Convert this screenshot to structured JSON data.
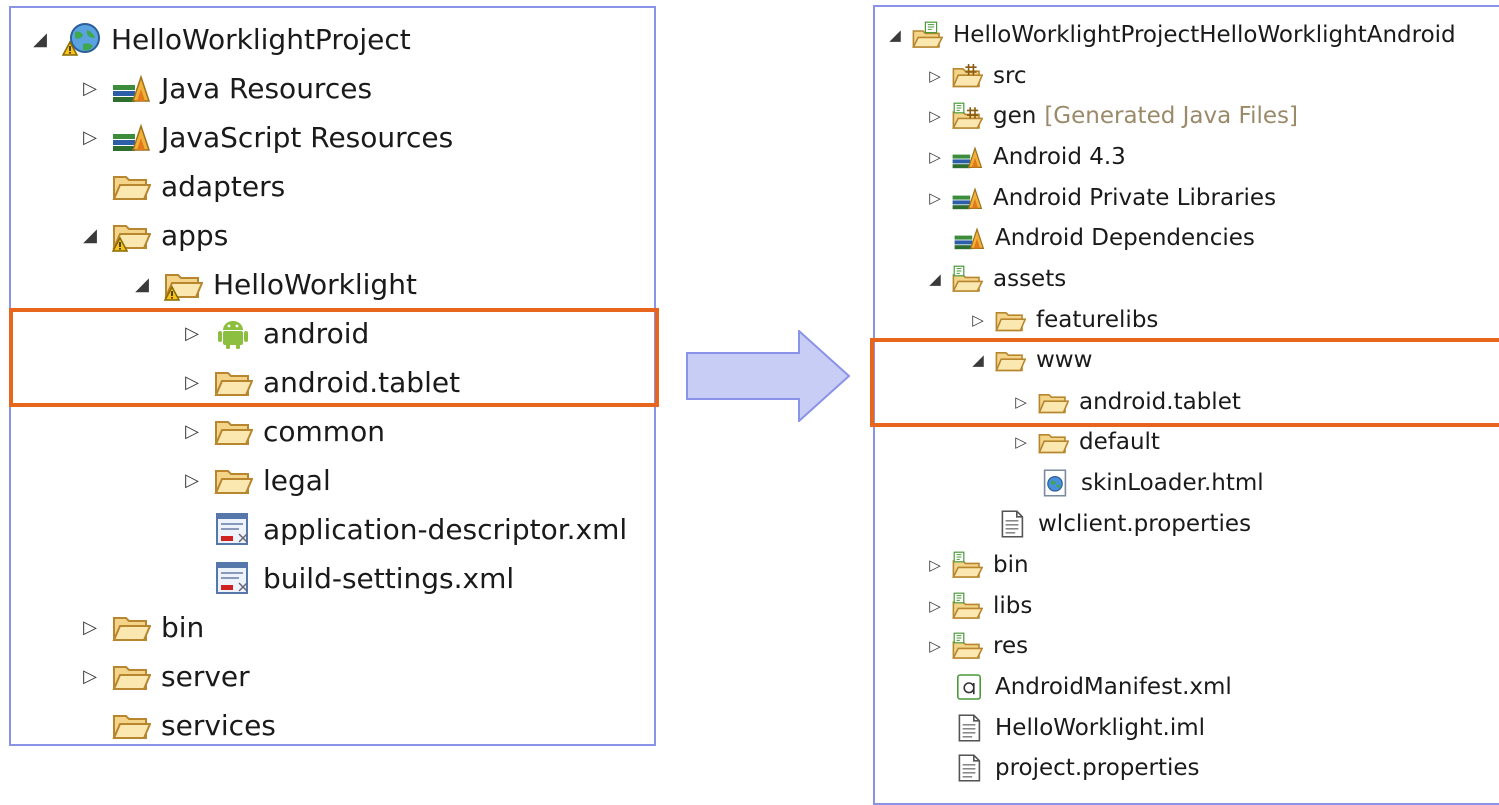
{
  "left_tree": {
    "project": "HelloWorklightProject",
    "java_resources": "Java Resources",
    "javascript_resources": "JavaScript Resources",
    "adapters": "adapters",
    "apps": "apps",
    "hello_worklight": "HelloWorklight",
    "android": "android",
    "android_tablet": "android.tablet",
    "common": "common",
    "legal": "legal",
    "application_descriptor": "application-descriptor.xml",
    "build_settings": "build-settings.xml",
    "bin": "bin",
    "server": "server",
    "services": "services"
  },
  "right_tree": {
    "project": "HelloWorklightProjectHelloWorklightAndroid",
    "src": "src",
    "gen": "gen",
    "gen_note": "[Generated Java Files]",
    "android_43": "Android 4.3",
    "android_private_libraries": "Android Private Libraries",
    "android_dependencies": "Android Dependencies",
    "assets": "assets",
    "featurelibs": "featurelibs",
    "www": "www",
    "android_tablet": "android.tablet",
    "default": "default",
    "skin_loader": "skinLoader.html",
    "wlclient_properties": "wlclient.properties",
    "bin": "bin",
    "libs": "libs",
    "res": "res",
    "android_manifest": "AndroidManifest.xml",
    "hello_worklight_iml": "HelloWorklight.iml",
    "project_properties": "project.properties"
  },
  "colors": {
    "panel_border": "#8a93e8",
    "highlight": "#e8651e",
    "arrow_fill": "#c8cdf5",
    "arrow_stroke": "#8a93e8"
  }
}
